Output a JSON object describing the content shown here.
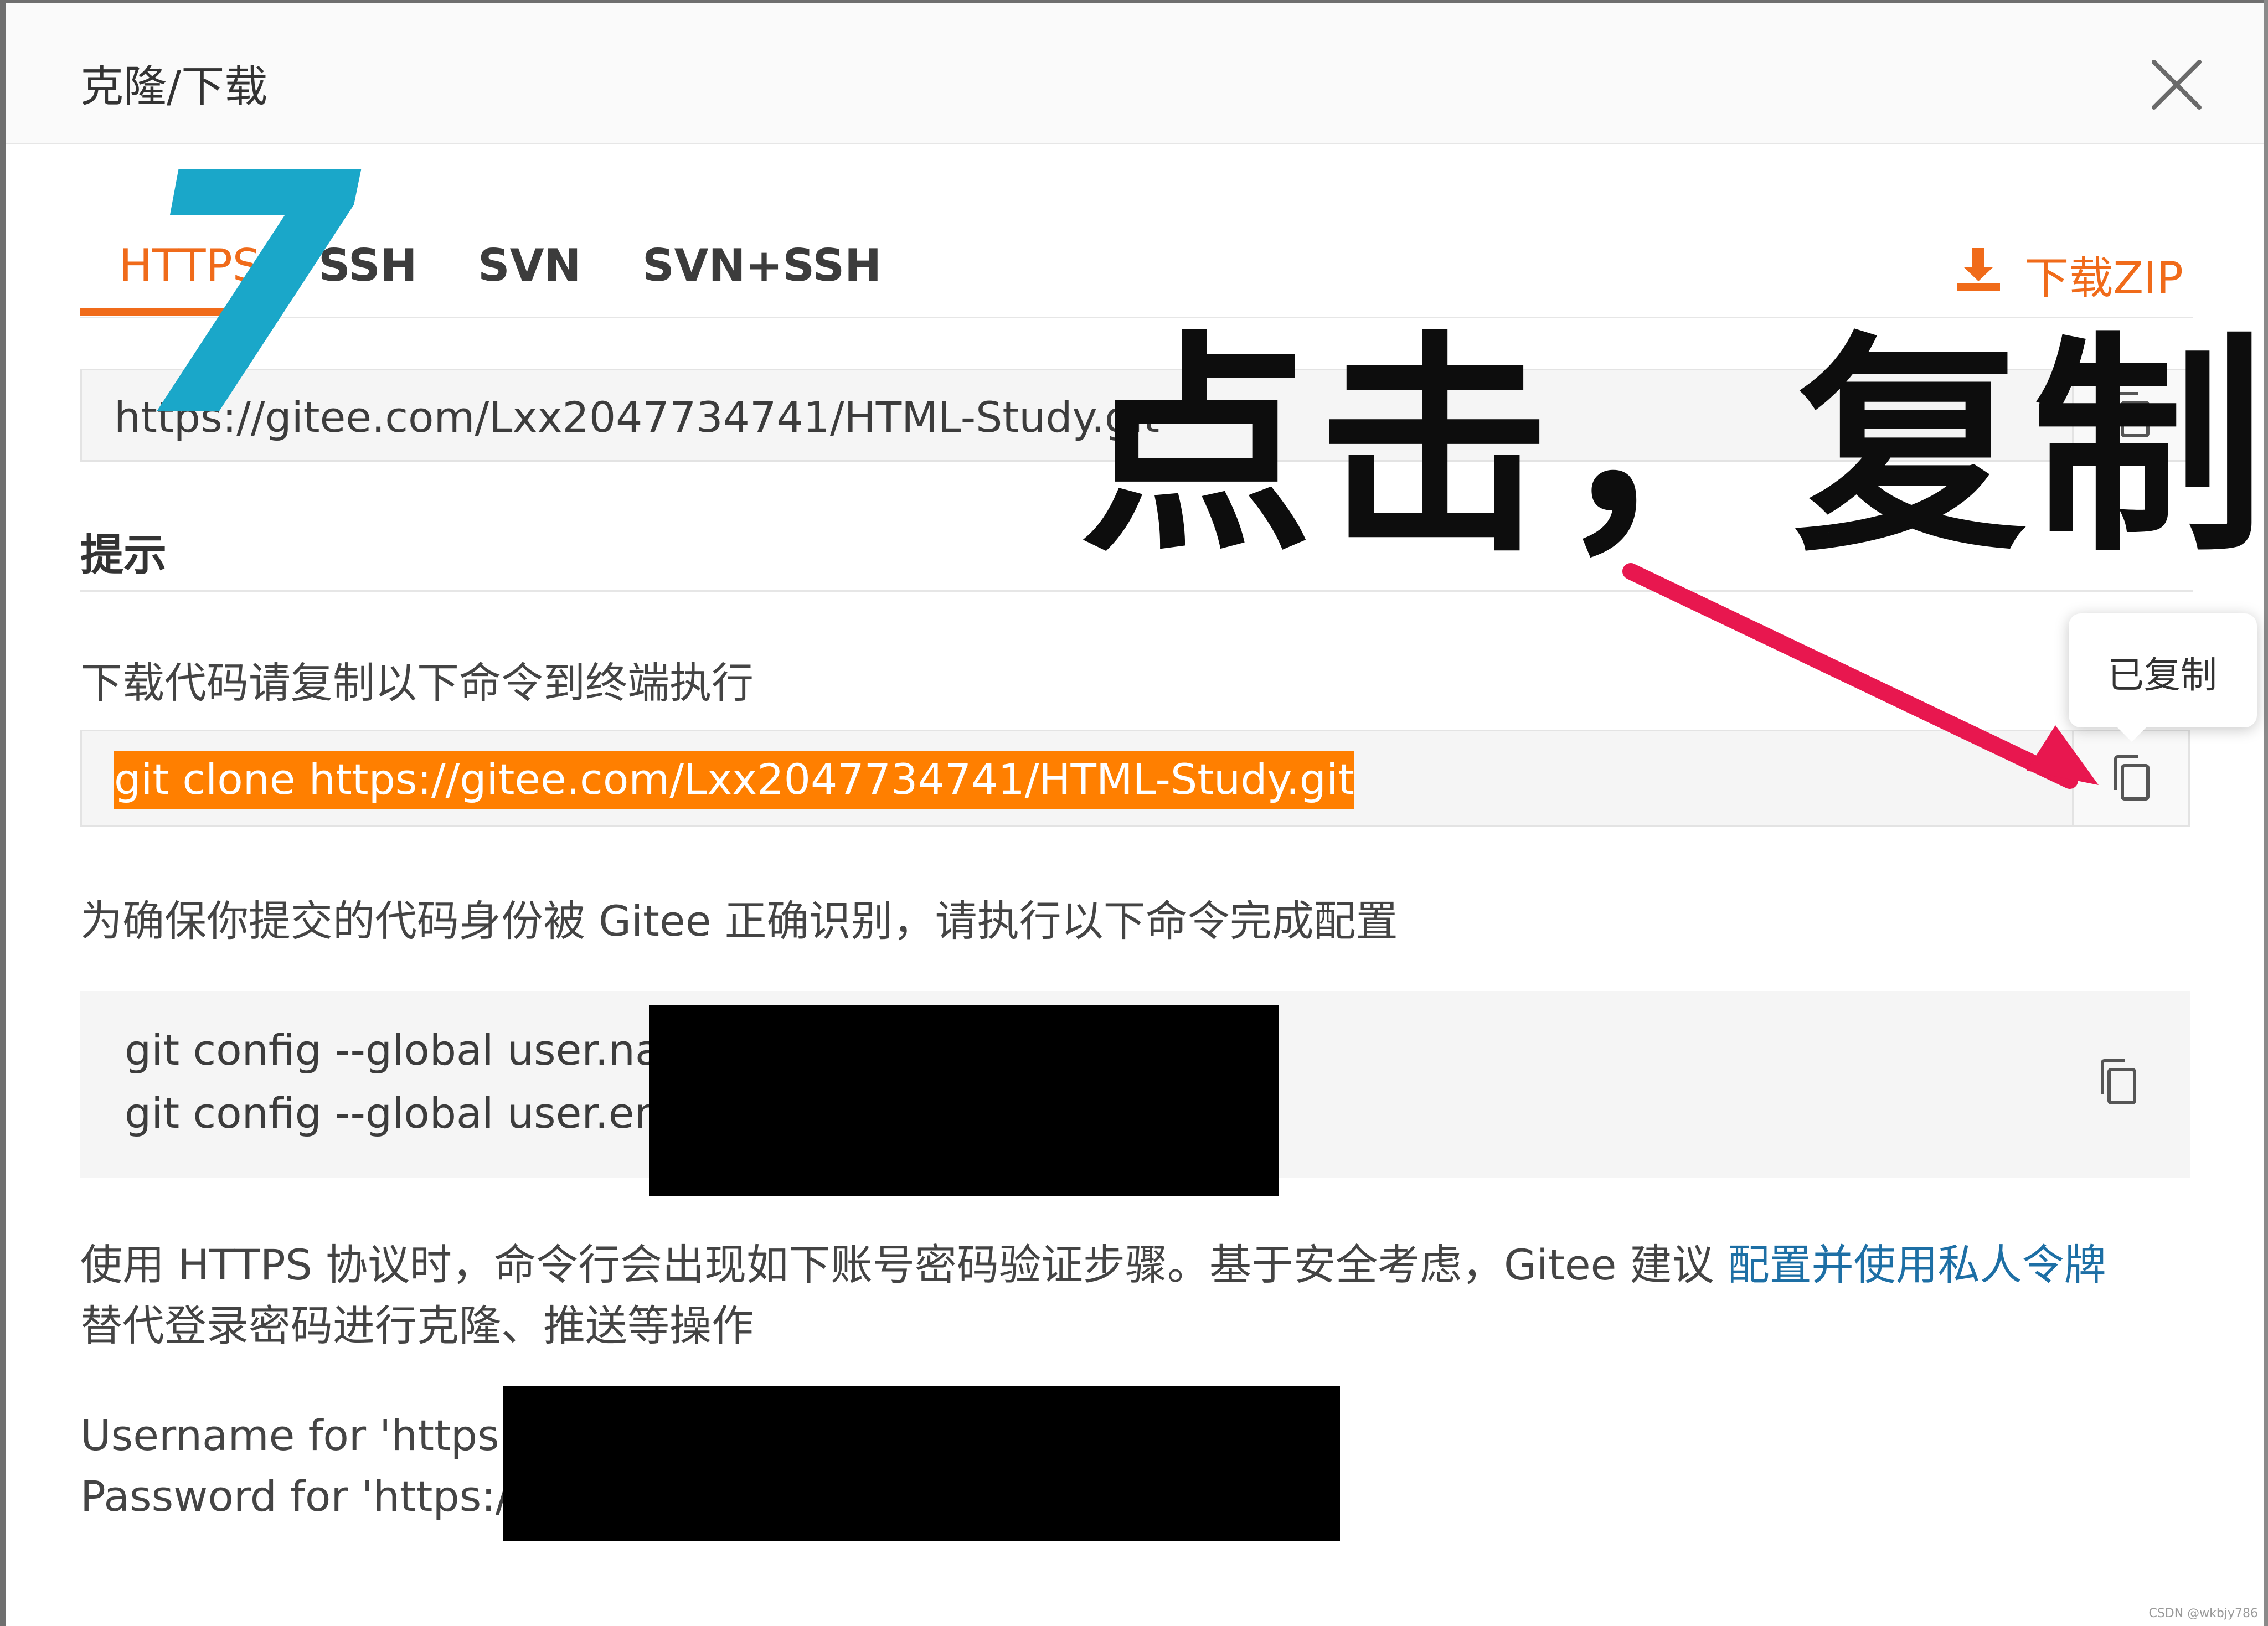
{
  "dialog": {
    "title": "克隆/下载"
  },
  "tabs": [
    {
      "label": "HTTPS",
      "active": true
    },
    {
      "label": "SSH",
      "active": false
    },
    {
      "label": "SVN",
      "active": false
    },
    {
      "label": "SVN+SSH",
      "active": false
    }
  ],
  "download_zip_label": "下载ZIP",
  "repo_url": "https://gitee.com/Lxx2047734741/HTML-Study.git",
  "hint_title": "提示",
  "cmd_intro": "下载代码请复制以下命令到终端执行",
  "clone_command": "git clone https://gitee.com/Lxx2047734741/HTML-Study.git",
  "tooltip_text": "已复制",
  "config_intro": "为确保你提交的代码身份被 Gitee 正确识别，请执行以下命令完成配置",
  "config_lines": [
    "git config --global user.nam",
    "git config --global user.ema"
  ],
  "https_note": {
    "text_before": "使用 HTTPS 协议时，命令行会出现如下账号密码验证步骤。基于安全考虑，Gitee 建议 ",
    "link": "配置并使用私人令牌",
    "text_after": "替代登录密码进行克隆、推送等操作"
  },
  "credential_lines": [
    "Username for 'https://",
    "Password for 'https://L"
  ],
  "annotations": {
    "step_number": "7",
    "callout": "点击，复制",
    "arrow_color": "#e8174f"
  },
  "watermark": "CSDN @wkbjy786",
  "colors": {
    "accent": "#f06b1a",
    "selection": "#ff7f00",
    "link": "#1d6fa5",
    "step_number": "#1aa7c9"
  }
}
